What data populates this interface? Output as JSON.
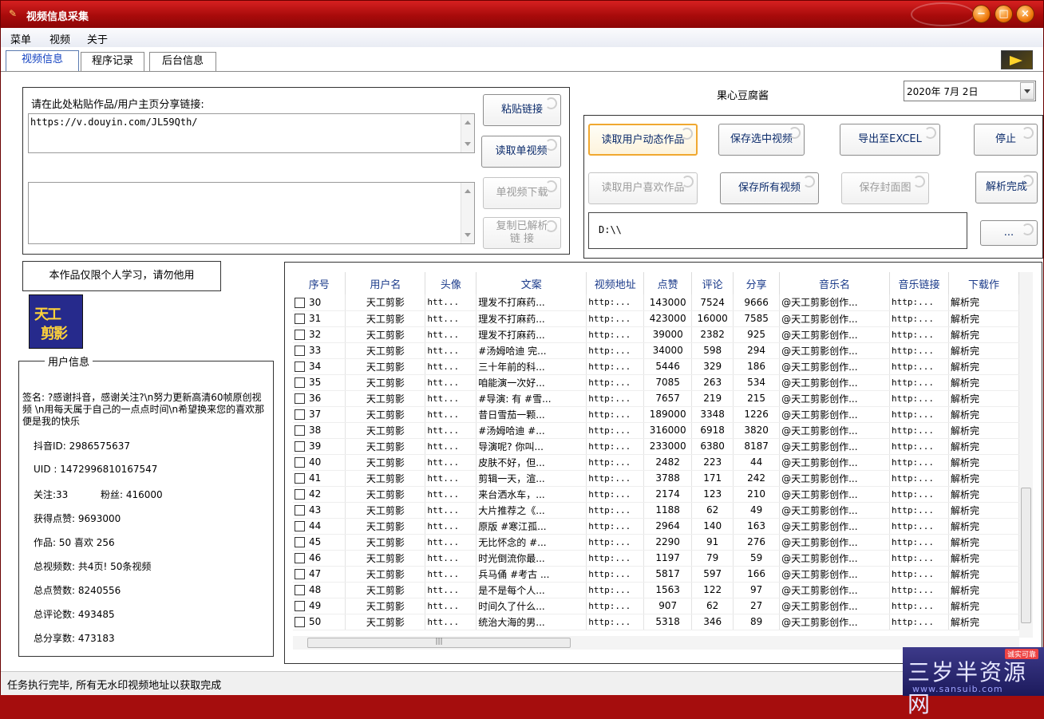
{
  "window": {
    "title": "视频信息采集",
    "controls": {
      "min": "−",
      "max": "□",
      "close": "×"
    }
  },
  "menu": [
    "菜单",
    "视频",
    "关于"
  ],
  "tabs": [
    "视频信息",
    "程序记录",
    "后台信息"
  ],
  "input": {
    "label": "请在此处粘贴作品/用户主页分享链接:",
    "link_value": "https://v.douyin.com/JL59Qth/",
    "output_value": ""
  },
  "buttons": {
    "paste": "粘贴链接",
    "read_single": "读取单视频",
    "download_single": "单视频下载",
    "copy_parsed": "复制已解析\n链 接",
    "read_user_posts": "读取用户动态作品",
    "save_selected": "保存选中视频",
    "export_excel": "导出至EXCEL",
    "stop": "停止",
    "read_user_likes": "读取用户喜欢作品",
    "save_all": "保存所有视频",
    "save_cover": "保存封面图",
    "parse_done": "解析完成",
    "browse": "..."
  },
  "user_nickname": "果心豆腐酱",
  "date_picker": "2020年 7月 2日",
  "save_path": "D:\\\\",
  "notice": "本作品仅限个人学习，请勿他用",
  "avatar_text": [
    "天工",
    "剪影"
  ],
  "user_info": {
    "group_title": "用户信息",
    "signature": "签名: ?感谢抖音，感谢关注?\\n努力更新高清60帧原创视频 \\n用每天属于自己的一点点时间\\n希望换来您的喜欢那便是我的快乐",
    "douyin_id": "抖音ID: 2986575637",
    "uid": "UID : 1472996810167547",
    "follow": "关注:33",
    "fans": "粉丝: 416000",
    "total_likes_received": "获得点赞: 9693000",
    "works_likes": "作品: 50 喜欢 256",
    "total_videos": "总视频数: 共4页! 50条视频",
    "total_diggs": "总点赞数: 8240556",
    "total_comments": "总评论数: 493485",
    "total_shares": "总分享数: 473183"
  },
  "grid": {
    "columns": [
      "序号",
      "用户名",
      "头像",
      "文案",
      "视频地址",
      "点赞",
      "评论",
      "分享",
      "音乐名",
      "音乐链接",
      "下载作"
    ],
    "rows": [
      [
        "30",
        "天工剪影",
        "htt...",
        "理发不打麻药...",
        "http:...",
        "143000",
        "7524",
        "9666",
        "@天工剪影创作...",
        "http:...",
        "解析完"
      ],
      [
        "31",
        "天工剪影",
        "htt...",
        "理发不打麻药...",
        "http:...",
        "423000",
        "16000",
        "7585",
        "@天工剪影创作...",
        "http:...",
        "解析完"
      ],
      [
        "32",
        "天工剪影",
        "htt...",
        "理发不打麻药...",
        "http:...",
        "39000",
        "2382",
        "925",
        "@天工剪影创作...",
        "http:...",
        "解析完"
      ],
      [
        "33",
        "天工剪影",
        "htt...",
        "#汤姆哈迪 完...",
        "http:...",
        "34000",
        "598",
        "294",
        "@天工剪影创作...",
        "http:...",
        "解析完"
      ],
      [
        "34",
        "天工剪影",
        "htt...",
        "三十年前的科...",
        "http:...",
        "5446",
        "329",
        "186",
        "@天工剪影创作...",
        "http:...",
        "解析完"
      ],
      [
        "35",
        "天工剪影",
        "htt...",
        "咱能演一次好...",
        "http:...",
        "7085",
        "263",
        "534",
        "@天工剪影创作...",
        "http:...",
        "解析完"
      ],
      [
        "36",
        "天工剪影",
        "htt...",
        "#导演: 有 #雪...",
        "http:...",
        "7657",
        "219",
        "215",
        "@天工剪影创作...",
        "http:...",
        "解析完"
      ],
      [
        "37",
        "天工剪影",
        "htt...",
        "昔日雪茄一颗...",
        "http:...",
        "189000",
        "3348",
        "1226",
        "@天工剪影创作...",
        "http:...",
        "解析完"
      ],
      [
        "38",
        "天工剪影",
        "htt...",
        "#汤姆哈迪  #...",
        "http:...",
        "316000",
        "6918",
        "3820",
        "@天工剪影创作...",
        "http:...",
        "解析完"
      ],
      [
        "39",
        "天工剪影",
        "htt...",
        "导演呢? 你叫...",
        "http:...",
        "233000",
        "6380",
        "8187",
        "@天工剪影创作...",
        "http:...",
        "解析完"
      ],
      [
        "40",
        "天工剪影",
        "htt...",
        "皮肤不好，但...",
        "http:...",
        "2482",
        "223",
        "44",
        "@天工剪影创作...",
        "http:...",
        "解析完"
      ],
      [
        "41",
        "天工剪影",
        "htt...",
        "剪辑一天，渲...",
        "http:...",
        "3788",
        "171",
        "242",
        "@天工剪影创作...",
        "http:...",
        "解析完"
      ],
      [
        "42",
        "天工剪影",
        "htt...",
        "来台洒水车，...",
        "http:...",
        "2174",
        "123",
        "210",
        "@天工剪影创作...",
        "http:...",
        "解析完"
      ],
      [
        "43",
        "天工剪影",
        "htt...",
        "大片推荐之《...",
        "http:...",
        "1188",
        "62",
        "49",
        "@天工剪影创作...",
        "http:...",
        "解析完"
      ],
      [
        "44",
        "天工剪影",
        "htt...",
        "原版  #寒江孤...",
        "http:...",
        "2964",
        "140",
        "163",
        "@天工剪影创作...",
        "http:...",
        "解析完"
      ],
      [
        "45",
        "天工剪影",
        "htt...",
        "无比怀念的 #...",
        "http:...",
        "2290",
        "91",
        "276",
        "@天工剪影创作...",
        "http:...",
        "解析完"
      ],
      [
        "46",
        "天工剪影",
        "htt...",
        "时光倒流你最...",
        "http:...",
        "1197",
        "79",
        "59",
        "@天工剪影创作...",
        "http:...",
        "解析完"
      ],
      [
        "47",
        "天工剪影",
        "htt...",
        "兵马俑 #考古 ...",
        "http:...",
        "5817",
        "597",
        "166",
        "@天工剪影创作...",
        "http:...",
        "解析完"
      ],
      [
        "48",
        "天工剪影",
        "htt...",
        "是不是每个人...",
        "http:...",
        "1563",
        "122",
        "97",
        "@天工剪影创作...",
        "http:...",
        "解析完"
      ],
      [
        "49",
        "天工剪影",
        "htt...",
        "时间久了什么...",
        "http:...",
        "907",
        "62",
        "27",
        "@天工剪影创作...",
        "http:...",
        "解析完"
      ],
      [
        "50",
        "天工剪影",
        "htt...",
        "统治大海的男...",
        "http:...",
        "5318",
        "346",
        "89",
        "@天工剪影创作...",
        "http:...",
        "解析完"
      ]
    ]
  },
  "status": "任务执行完毕, 所有无水印视频地址以获取完成",
  "watermark": {
    "main": "三岁半资源网",
    "url": "www.sansuib.com",
    "tag": "诚实可靠"
  }
}
